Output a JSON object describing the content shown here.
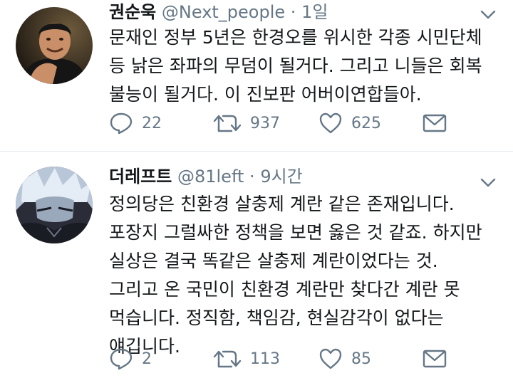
{
  "tweets": [
    {
      "display_name": "권순욱",
      "handle": "@Next_people",
      "separator": "·",
      "time": "1일",
      "lines": [
        "문재인 정부 5년은 한경오를 위시한 각종 시민단체",
        "등 낡은 좌파의 무덤이 될거다. 그리고 니들은 회복",
        "불능이 될거다. 이 진보판 어버이연합들아."
      ],
      "replies": "22",
      "retweets": "937",
      "likes": "625"
    },
    {
      "display_name": "더레프트",
      "handle": "@81left",
      "separator": "·",
      "time": "9시간",
      "lines": [
        "정의당은 친환경 살충제 계란 같은 존재입니다.",
        "포장지 그럴싸한 정책을 보면 옳은 것 같죠. 하지만",
        "실상은 결국 똑같은 살충제 계란이었다는 것.",
        "그리고 온 국민이 친환경 계란만 찾다간 계란 못",
        "먹습니다. 정직함, 책임감, 현실감각이 없다는",
        "얘깁니다."
      ],
      "replies": "2",
      "retweets": "113",
      "likes": "85"
    }
  ],
  "icons": {
    "reply": "reply-icon",
    "retweet": "retweet-icon",
    "like": "heart-icon",
    "message": "envelope-icon",
    "caret": "chevron-down-icon"
  },
  "colors": {
    "icon_gray": "#657786",
    "text": "#14171a",
    "divider": "#e6ecf0"
  }
}
